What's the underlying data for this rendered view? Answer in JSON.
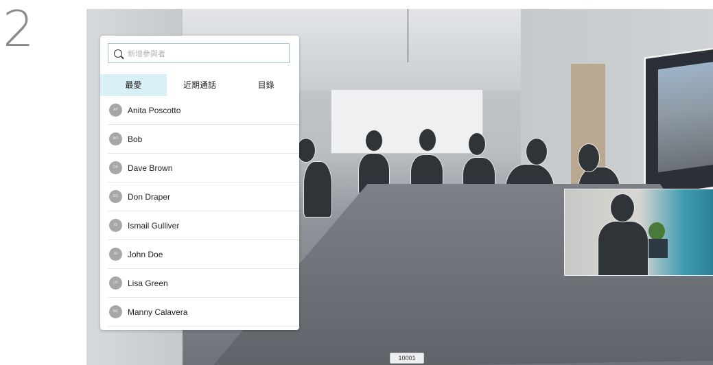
{
  "step_number": "2",
  "search": {
    "placeholder": "新增參與者"
  },
  "tabs": [
    {
      "label": "最愛",
      "active": true
    },
    {
      "label": "近期通話",
      "active": false
    },
    {
      "label": "目錄",
      "active": false
    }
  ],
  "contacts": [
    {
      "initials": "AP",
      "name": "Anita Poscotto"
    },
    {
      "initials": "BO",
      "name": "Bob"
    },
    {
      "initials": "DB",
      "name": "Dave Brown"
    },
    {
      "initials": "DD",
      "name": "Don Draper"
    },
    {
      "initials": "IG",
      "name": "Ismail Gulliver"
    },
    {
      "initials": "JD",
      "name": "John Doe"
    },
    {
      "initials": "LG",
      "name": "Lisa Green"
    },
    {
      "initials": "MC",
      "name": "Manny Calavera"
    }
  ],
  "call_id": "10001",
  "colors": {
    "active_tab": "#d9f0f7",
    "search_border": "#9cc7d3",
    "avatar": "#a7a7a7"
  }
}
